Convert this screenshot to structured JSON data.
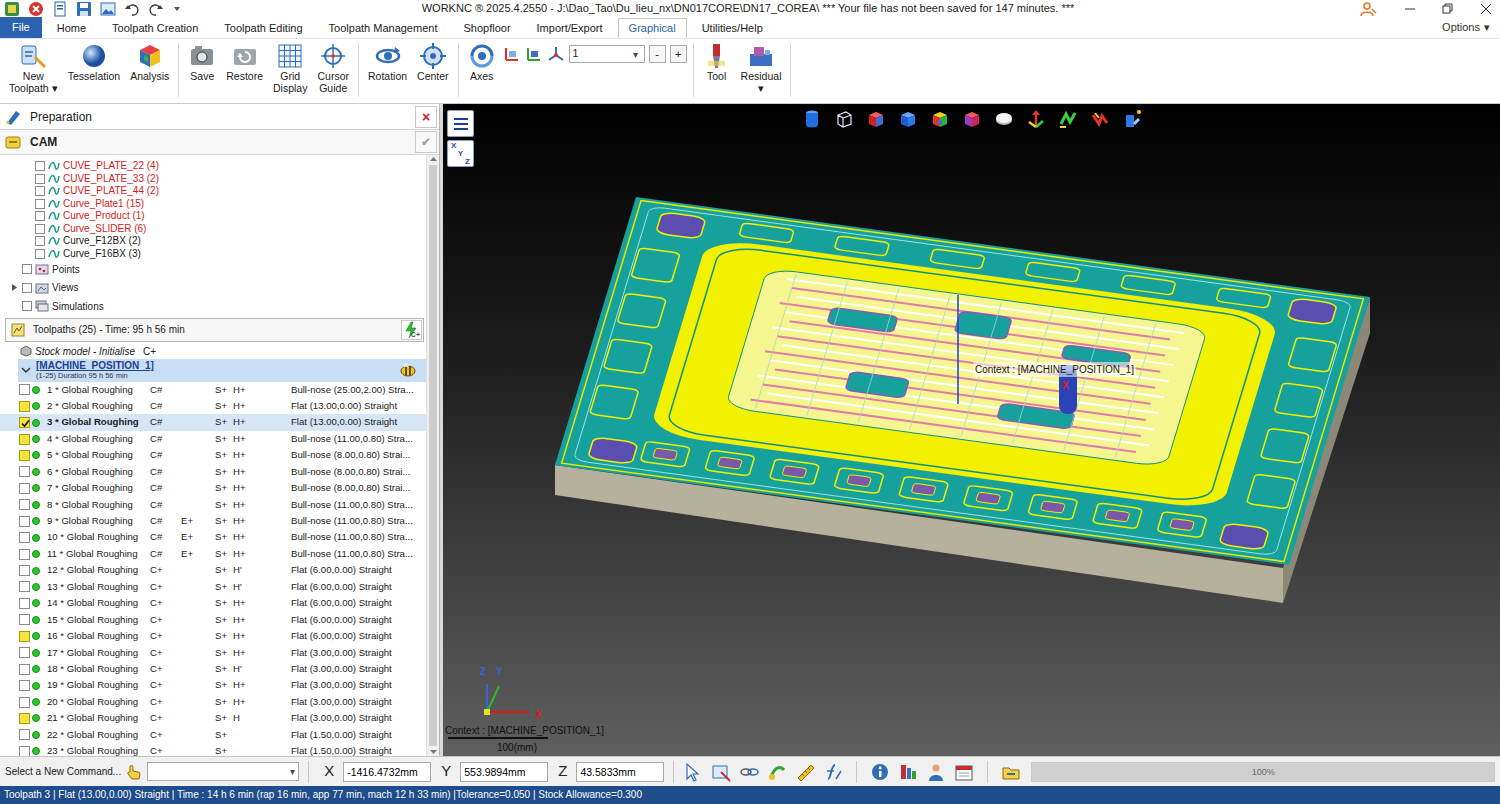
{
  "window": {
    "title": "WORKNC ® 2025.4.2550 - J:\\Dao_Tao\\Du_lieu_nx\\DN017CORE\\DN17_COREA\\ *** Your file has not been saved for 147 minutes. ***"
  },
  "menu": {
    "file": "File",
    "tabs": [
      {
        "label": "Home",
        "selected": false
      },
      {
        "label": "Toolpath Creation",
        "selected": false
      },
      {
        "label": "Toolpath Editing",
        "selected": false
      },
      {
        "label": "Toolpath Management",
        "selected": false
      },
      {
        "label": "Shopfloor",
        "selected": false
      },
      {
        "label": "Import/Export",
        "selected": false
      },
      {
        "label": "Graphical",
        "selected": true
      },
      {
        "label": "Utilities/Help",
        "selected": false
      }
    ],
    "options": {
      "label": "Options",
      "caret": "▾"
    }
  },
  "ribbon": {
    "buttons": [
      {
        "lines": [
          "New",
          "Toolpath ▾"
        ]
      },
      {
        "lines": [
          "Tesselation"
        ]
      },
      {
        "lines": [
          "Analysis"
        ]
      },
      {
        "lines": [
          "Save"
        ]
      },
      {
        "lines": [
          "Restore"
        ]
      },
      {
        "lines": [
          "Grid",
          "Display"
        ]
      },
      {
        "lines": [
          "Cursor",
          "Guide"
        ]
      },
      {
        "lines": [
          "Rotation"
        ]
      },
      {
        "lines": [
          "Center"
        ]
      },
      {
        "lines": [
          "Axes"
        ]
      },
      {
        "lines": [
          "Tool"
        ]
      },
      {
        "lines": [
          "Residual",
          "▾"
        ]
      }
    ],
    "view_combo": {
      "value": "1",
      "caret": "▾",
      "minus": "-",
      "plus": "+"
    }
  },
  "panel": {
    "title": "Preparation",
    "close": "×",
    "cam": "CAM",
    "confirm": "✔"
  },
  "tree": {
    "curves": [
      {
        "label": "CUVE_PLATE_22 (4)",
        "checked": false,
        "color": "#d42020"
      },
      {
        "label": "CUVE_PLATE_33 (2)",
        "checked": false,
        "color": "#d42020"
      },
      {
        "label": "CUVE_PLATE_44 (2)",
        "checked": false,
        "color": "#d42020"
      },
      {
        "label": "Curve_Plate1 (15)",
        "checked": false,
        "color": "#d42020"
      },
      {
        "label": "Curve_Product (1)",
        "checked": false,
        "color": "#d42020"
      },
      {
        "label": "Curve_SLIDER (6)",
        "checked": false,
        "color": "#d42020"
      },
      {
        "label": "Curve_F12BX (2)",
        "checked": false,
        "color": "#1a1a1a"
      },
      {
        "label": "Curve_F16BX (3)",
        "checked": false,
        "color": "#1a1a1a"
      }
    ],
    "nodes": [
      {
        "label": "Points",
        "checked": false,
        "expandable": false
      },
      {
        "label": "Views",
        "checked": false,
        "expandable": true
      },
      {
        "label": "Simulations",
        "checked": false,
        "expandable": false
      }
    ]
  },
  "toolpaths_bar": {
    "label": "Toolpaths (25) - Time: 95 h 56 min",
    "button": "C+"
  },
  "stock": {
    "label": "Stock model - Initialise",
    "flag": "C+"
  },
  "machine": {
    "label": "[MACHINE_POSITION_1]",
    "detail": "(1-25) Duration 95 h 56 min",
    "expanded": true
  },
  "toolpaths": [
    {
      "label": "1 * Global Roughing",
      "c": "C#",
      "e": "",
      "s": "S+",
      "h": "H+",
      "tool": "Bull-nose (25.00,2.00) Stra...",
      "visible": false,
      "checked": false,
      "selected": false,
      "computed": true
    },
    {
      "label": "2 * Global Roughing",
      "c": "C#",
      "e": "",
      "s": "S+",
      "h": "H+",
      "tool": "Flat (13.00,0.00) Straight",
      "visible": true,
      "checked": false,
      "selected": false,
      "computed": true
    },
    {
      "label": "3 * Global Roughing",
      "c": "C#",
      "e": "",
      "s": "S+",
      "h": "H+",
      "tool": "Flat (13.00,0.00) Straight",
      "visible": true,
      "checked": true,
      "selected": true,
      "computed": true
    },
    {
      "label": "4 * Global Roughing",
      "c": "C#",
      "e": "",
      "s": "S+",
      "h": "H+",
      "tool": "Bull-nose (11.00,0.80) Stra...",
      "visible": true,
      "checked": false,
      "selected": false,
      "computed": true
    },
    {
      "label": "5 * Global Roughing",
      "c": "C#",
      "e": "",
      "s": "S+",
      "h": "H+",
      "tool": "Bull-nose (8.00,0.80) Strai...",
      "visible": true,
      "checked": false,
      "selected": false,
      "computed": true
    },
    {
      "label": "6 * Global Roughing",
      "c": "C#",
      "e": "",
      "s": "S+",
      "h": "H+",
      "tool": "Bull-nose (8.00,0.80) Strai...",
      "visible": false,
      "checked": false,
      "selected": false,
      "computed": true
    },
    {
      "label": "7 * Global Roughing",
      "c": "C#",
      "e": "",
      "s": "S+",
      "h": "H+",
      "tool": "Bull-nose (8.00,0.80) Strai...",
      "visible": false,
      "checked": false,
      "selected": false,
      "computed": true
    },
    {
      "label": "8 * Global Roughing",
      "c": "C#",
      "e": "",
      "s": "S+",
      "h": "H+",
      "tool": "Bull-nose (11.00,0.80) Stra...",
      "visible": false,
      "checked": false,
      "selected": false,
      "computed": true
    },
    {
      "label": "9 * Global Roughing",
      "c": "C#",
      "e": "E+",
      "s": "S+",
      "h": "H+",
      "tool": "Bull-nose (11.00,0.80) Stra...",
      "visible": false,
      "checked": false,
      "selected": false,
      "computed": true
    },
    {
      "label": "10 * Global Roughing",
      "c": "C#",
      "e": "E+",
      "s": "S+",
      "h": "H+",
      "tool": "Bull-nose (11.00,0.80) Stra...",
      "visible": false,
      "checked": false,
      "selected": false,
      "computed": true
    },
    {
      "label": "11 * Global Roughing",
      "c": "C#",
      "e": "E+",
      "s": "S+",
      "h": "H+",
      "tool": "Bull-nose (11.00,0.80) Stra...",
      "visible": false,
      "checked": false,
      "selected": false,
      "computed": true
    },
    {
      "label": "12 * Global Roughing",
      "c": "C+",
      "e": "",
      "s": "S+",
      "h": "H'",
      "tool": "Flat (6.00,0.00) Straight",
      "visible": false,
      "checked": false,
      "selected": false,
      "computed": true
    },
    {
      "label": "13 * Global Roughing",
      "c": "C+",
      "e": "",
      "s": "S+",
      "h": "H'",
      "tool": "Flat (6.00,0.00) Straight",
      "visible": false,
      "checked": false,
      "selected": false,
      "computed": true
    },
    {
      "label": "14 * Global Roughing",
      "c": "C+",
      "e": "",
      "s": "S+",
      "h": "H+",
      "tool": "Flat (6.00,0.00) Straight",
      "visible": false,
      "checked": false,
      "selected": false,
      "computed": true
    },
    {
      "label": "15 * Global Roughing",
      "c": "C+",
      "e": "",
      "s": "S+",
      "h": "H+",
      "tool": "Flat (6.00,0.00) Straight",
      "visible": false,
      "checked": false,
      "selected": false,
      "computed": true
    },
    {
      "label": "16 * Global Roughing",
      "c": "C+",
      "e": "",
      "s": "S+",
      "h": "H+",
      "tool": "Flat (6.00,0.00) Straight",
      "visible": true,
      "checked": false,
      "selected": false,
      "computed": true
    },
    {
      "label": "17 * Global Roughing",
      "c": "C+",
      "e": "",
      "s": "S+",
      "h": "H+",
      "tool": "Flat (3.00,0.00) Straight",
      "visible": false,
      "checked": false,
      "selected": false,
      "computed": true
    },
    {
      "label": "18 * Global Roughing",
      "c": "C+",
      "e": "",
      "s": "S+",
      "h": "H'",
      "tool": "Flat (3.00,0.00) Straight",
      "visible": false,
      "checked": false,
      "selected": false,
      "computed": true
    },
    {
      "label": "19 * Global Roughing",
      "c": "C+",
      "e": "",
      "s": "S+",
      "h": "H+",
      "tool": "Flat (3.00,0.00) Straight",
      "visible": false,
      "checked": false,
      "selected": false,
      "computed": true
    },
    {
      "label": "20 * Global Roughing",
      "c": "C+",
      "e": "",
      "s": "S+",
      "h": "H+",
      "tool": "Flat (3.00,0.00) Straight",
      "visible": false,
      "checked": false,
      "selected": false,
      "computed": true
    },
    {
      "label": "21 * Global Roughing",
      "c": "C+",
      "e": "",
      "s": "S+",
      "h": "H",
      "tool": "Flat (3.00,0.00) Straight",
      "visible": true,
      "checked": false,
      "selected": false,
      "computed": true
    },
    {
      "label": "22 * Global Roughing",
      "c": "C+",
      "e": "",
      "s": "S+",
      "h": "",
      "tool": "Flat (1.50,0.00) Straight",
      "visible": false,
      "checked": false,
      "selected": false,
      "computed": true
    },
    {
      "label": "23 * Global Roughing",
      "c": "C+",
      "e": "",
      "s": "S+",
      "h": "",
      "tool": "Flat (1.50,0.00) Straight",
      "visible": false,
      "checked": false,
      "selected": false,
      "computed": true
    }
  ],
  "viewport": {
    "xyz_button": [
      "X",
      "Y",
      "Z"
    ],
    "context_label": "Context : [MACHINE_POSITION_1]",
    "marker": "X",
    "axes": {
      "x": "X",
      "y": "Y",
      "z": "Z"
    },
    "footer_context": "Context : [MACHINE_POSITION_1]",
    "scale": "100(mm)"
  },
  "command": {
    "prompt": "Select a New Command...",
    "combo": {
      "value": "",
      "caret": "▾"
    },
    "coords": [
      {
        "axis": "X",
        "value": "-1416.4732mm"
      },
      {
        "axis": "Y",
        "value": "553.9894mm"
      },
      {
        "axis": "Z",
        "value": "43.5833mm"
      }
    ],
    "progress": {
      "level": 1,
      "reading": "100%"
    }
  },
  "status_bar": {
    "text": "Toolpath 3 | Flat (13.00,0.00) Straight | Time : 14 h 6 min (rap 16 min, app 77 min, mach 12 h 33 min) |Tolerance=0.050 | Stock Allowance=0.300"
  }
}
